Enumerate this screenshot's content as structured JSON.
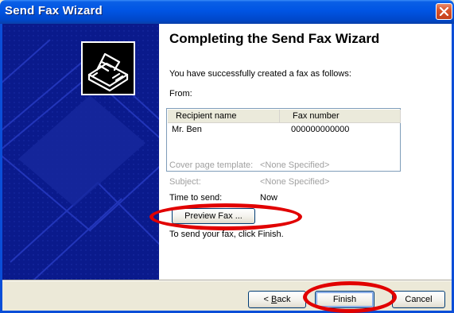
{
  "window": {
    "title": "Send Fax Wizard",
    "close_icon": "close-icon"
  },
  "side_panel": {
    "icon": "fax-machine-icon",
    "colors": {
      "background": "#0a1a8c",
      "accent": "#2a3fc8"
    }
  },
  "main": {
    "heading": "Completing the Send Fax Wizard",
    "intro": "You have successfully created a fax as follows:",
    "from_label": "From:",
    "recipients": {
      "columns": [
        "Recipient name",
        "Fax number"
      ],
      "rows": [
        {
          "name": "Mr. Ben",
          "fax": "000000000000"
        }
      ]
    },
    "cover_page": {
      "label": "Cover page template:",
      "value": "<None Specified>"
    },
    "subject": {
      "label": "Subject:",
      "value": "<None Specified>"
    },
    "time_to_send": {
      "label": "Time to send:",
      "value": "Now"
    },
    "preview_button": "Preview Fax ...",
    "finish_instruction": "To send your fax, click Finish."
  },
  "footer": {
    "back_button": {
      "prefix": "< ",
      "mnemonic": "B",
      "rest": "ack"
    },
    "finish_button": "Finish",
    "cancel_button": "Cancel"
  },
  "annotations": {
    "highlight_color": "#e10000"
  }
}
